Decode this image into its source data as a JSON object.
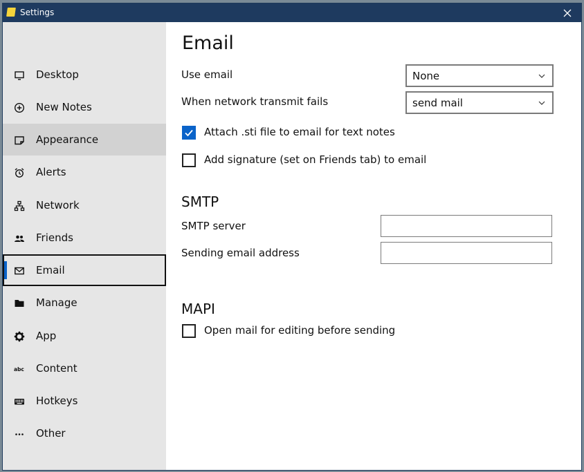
{
  "window": {
    "title": "Settings",
    "app_icon": "sticky-note-icon",
    "close_icon": "close-icon"
  },
  "sidebar": {
    "items": [
      {
        "label": "Desktop",
        "icon": "monitor-icon"
      },
      {
        "label": "New Notes",
        "icon": "plus-circle-icon"
      },
      {
        "label": "Appearance",
        "icon": "note-icon"
      },
      {
        "label": "Alerts",
        "icon": "alarm-clock-icon"
      },
      {
        "label": "Network",
        "icon": "network-icon"
      },
      {
        "label": "Friends",
        "icon": "people-icon"
      },
      {
        "label": "Email",
        "icon": "envelope-icon"
      },
      {
        "label": "Manage",
        "icon": "folder-icon"
      },
      {
        "label": "App",
        "icon": "gear-icon"
      },
      {
        "label": "Content",
        "icon": "abc-icon"
      },
      {
        "label": "Hotkeys",
        "icon": "keyboard-icon"
      },
      {
        "label": "Other",
        "icon": "ellipsis-icon"
      }
    ],
    "selected": "Email",
    "hovered": "Appearance"
  },
  "main": {
    "title": "Email",
    "use_email": {
      "label": "Use email",
      "value": "None"
    },
    "transmit_fails": {
      "label": "When network transmit fails",
      "value": "send mail"
    },
    "attach_sti": {
      "label": "Attach .sti file to email for text notes",
      "checked": true
    },
    "add_signature": {
      "label": "Add signature (set on Friends tab) to email",
      "checked": false
    },
    "smtp": {
      "heading": "SMTP",
      "server_label": "SMTP server",
      "server_value": "",
      "sender_label": "Sending email address",
      "sender_value": ""
    },
    "mapi": {
      "heading": "MAPI",
      "open_mail": {
        "label": "Open mail for editing before sending",
        "checked": false
      }
    }
  },
  "colors": {
    "titlebar": "#1e3a5f",
    "sidebar": "#e6e6e6",
    "accent": "#0a63c9"
  }
}
